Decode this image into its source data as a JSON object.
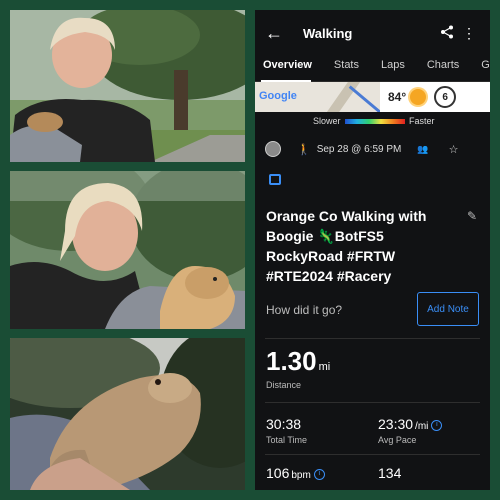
{
  "app": {
    "title": "Walking",
    "tabs": [
      "Overview",
      "Stats",
      "Laps",
      "Charts",
      "Ge"
    ],
    "active_tab": "Overview"
  },
  "map": {
    "provider": "Google",
    "temperature": "84°",
    "wind_speed": "6"
  },
  "legend": {
    "slower": "Slower",
    "faster": "Faster"
  },
  "meta": {
    "date": "Sep 28 @ 6:59 PM"
  },
  "activity": {
    "title": "Orange Co Walking with Boogie 🦎BotFS5 RockyRoad #FRTW #RTE2024 #Racery",
    "prompt": "How did it go?",
    "add_note": "Add Note"
  },
  "stats": {
    "distance_value": "1.30",
    "distance_unit": "mi",
    "distance_label": "Distance",
    "total_time_value": "30:38",
    "total_time_label": "Total Time",
    "avg_pace_value": "23:30",
    "avg_pace_unit": "/mi",
    "avg_pace_label": "Avg Pace",
    "heart_rate_value": "106",
    "heart_rate_unit": "bpm",
    "other_value": "134"
  },
  "colors": {
    "background": "#1a4d35",
    "phone_bg": "#111214",
    "accent": "#3a8ef6"
  },
  "icons": [
    "back-arrow-icon",
    "share-icon",
    "more-vert-icon",
    "walk-icon",
    "people-icon",
    "star-icon",
    "image-icon",
    "edit-icon",
    "info-icon",
    "sun-icon"
  ]
}
